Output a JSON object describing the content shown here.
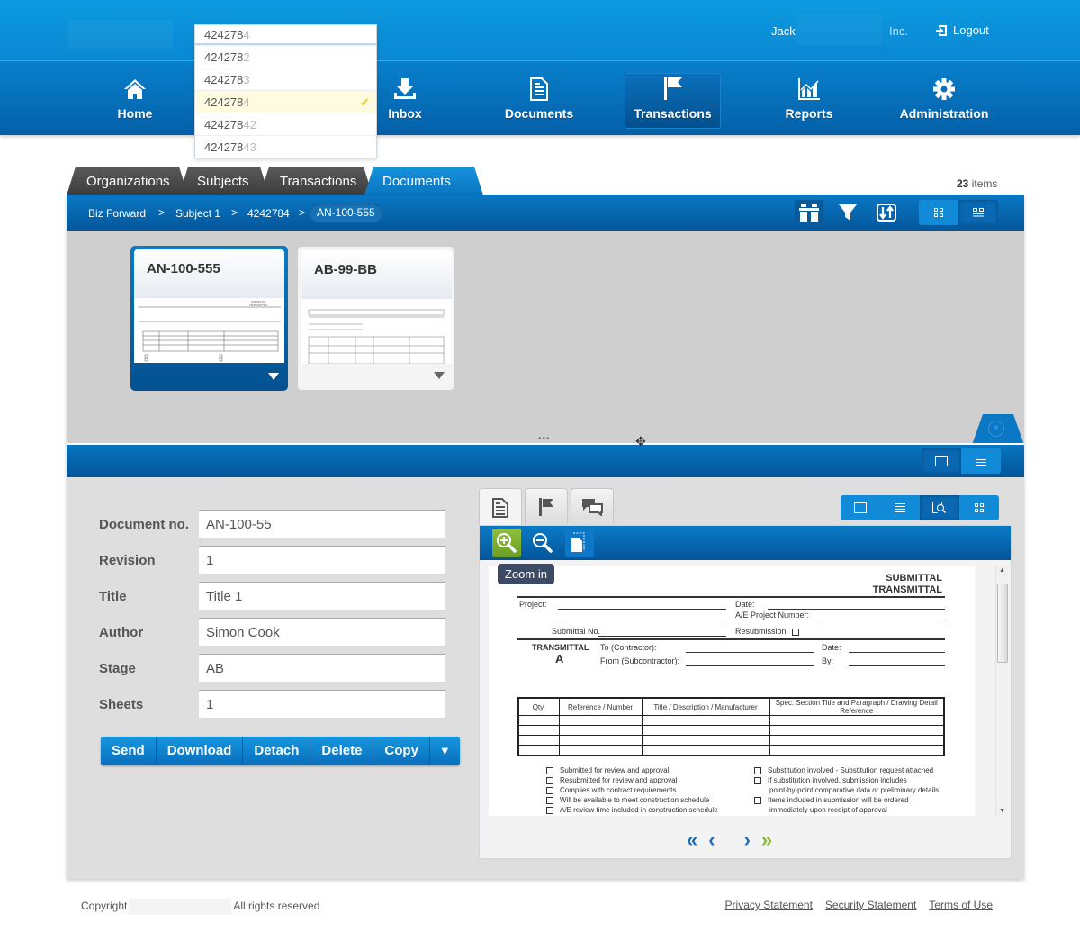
{
  "header": {
    "user_name": "Jack",
    "company_suffix": "Inc.",
    "logout_label": "Logout"
  },
  "search_dropdown": {
    "input_value_prefix": "424278",
    "input_value_suffix": "4",
    "options": [
      {
        "prefix": "424278",
        "suffix": "2",
        "selected": false
      },
      {
        "prefix": "424278",
        "suffix": "3",
        "selected": false
      },
      {
        "prefix": "424278",
        "suffix": "4",
        "selected": true
      },
      {
        "prefix": "424278",
        "suffix": "42",
        "selected": false
      },
      {
        "prefix": "424278",
        "suffix": "43",
        "selected": false
      }
    ],
    "selected_mark": "✓"
  },
  "nav": {
    "items": [
      {
        "label": "Home",
        "icon": "home-icon"
      },
      {
        "label": "Inbox",
        "icon": "download-icon"
      },
      {
        "label": "Documents",
        "icon": "document-icon"
      },
      {
        "label": "Transactions",
        "icon": "flag-icon",
        "active": true
      },
      {
        "label": "Reports",
        "icon": "chart-icon"
      },
      {
        "label": "Administration",
        "icon": "gear-icon"
      }
    ]
  },
  "tabs": {
    "items": [
      {
        "label": "Organizations"
      },
      {
        "label": "Subjects"
      },
      {
        "label": "Transactions"
      },
      {
        "label": "Documents",
        "active": true,
        "closable": true
      }
    ],
    "close_glyph": "×"
  },
  "items_count": {
    "number": "23",
    "label": "items"
  },
  "breadcrumb": {
    "items": [
      "Biz Forward",
      "Subject 1",
      "4242784"
    ],
    "current": "AN-100-555",
    "separator": ">"
  },
  "documents": [
    {
      "title": "AN-100-555",
      "selected": true
    },
    {
      "title": "AB-99-BB",
      "selected": false
    }
  ],
  "splitter": {
    "dots": "•••",
    "close_glyph": "×"
  },
  "form": {
    "fields": [
      {
        "label": "Document no.",
        "value": "AN-100-55"
      },
      {
        "label": "Revision",
        "value": "1"
      },
      {
        "label": "Title",
        "value": "Title 1"
      },
      {
        "label": "Author",
        "value": "Simon Cook"
      },
      {
        "label": "Stage",
        "value": "AB"
      },
      {
        "label": "Sheets",
        "value": "1"
      }
    ],
    "actions": [
      "Send",
      "Download",
      "Detach",
      "Delete",
      "Copy"
    ],
    "more_glyph": "▼"
  },
  "viewer": {
    "tooltip": "Zoom in",
    "pager": {
      "first": "«",
      "prev": "‹",
      "next": "›",
      "last": "»"
    },
    "document": {
      "heading_line1": "SUBMITTAL",
      "heading_line2": "TRANSMITTAL",
      "project_label": "Project:",
      "date_label": "Date:",
      "ae_label": "A/E Project Number:",
      "submittal_no_label": "Submittal No.",
      "resubmission_label": "Resubmission",
      "transmittal_label": "TRANSMITTAL",
      "transmittal_letter": "A",
      "to_label": "To (Contractor):",
      "from_label": "From (Subcontractor):",
      "date2_label": "Date:",
      "by_label": "By:",
      "table_headers": [
        "Qty.",
        "Reference / Number",
        "Title / Description / Manufacturer",
        "Spec. Section Title and Paragraph / Drawing Detail Reference"
      ],
      "table_rows": 4,
      "checks_left": [
        "Submitted for review and approval",
        "Resubmitted for review and approval",
        "Complies with contract requirements",
        "Will be available to meet construction schedule",
        "A/E review time included in construction schedule"
      ],
      "checks_right": [
        {
          "text": "Substitution involved - Substitution request attached",
          "box": true
        },
        {
          "text": "If substitution involved, submission includes",
          "box": true
        },
        {
          "text": "point-by-point comparative data or preliminary details",
          "box": false
        },
        {
          "text": "Items included in submission will be ordered",
          "box": true
        },
        {
          "text": "immediately upon receipt of approval",
          "box": false
        }
      ]
    }
  },
  "footer": {
    "copyright": "Copyright",
    "rights": "All rights reserved",
    "links": [
      "Privacy Statement",
      "Security Statement",
      "Terms of Use"
    ]
  }
}
